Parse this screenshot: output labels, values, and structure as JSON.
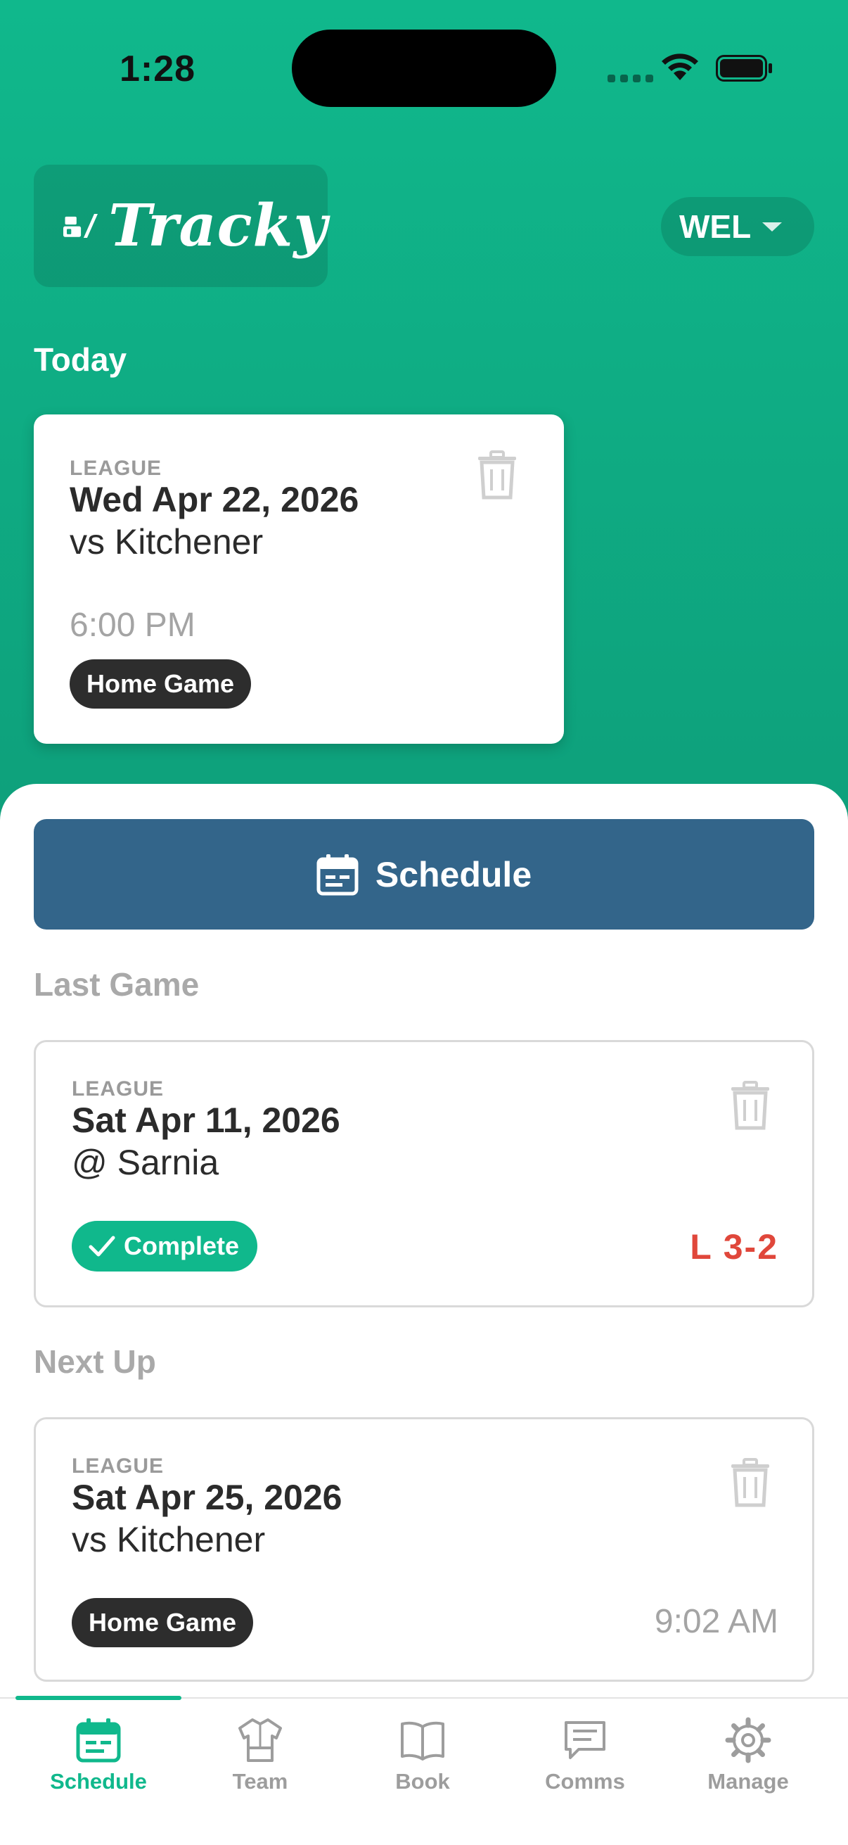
{
  "status_bar": {
    "time": "1:28"
  },
  "header": {
    "app_name": "Tracky",
    "team_code": "WEL"
  },
  "today": {
    "label": "Today",
    "game": {
      "type": "LEAGUE",
      "date": "Wed Apr 22, 2026",
      "opponent": "vs Kitchener",
      "time": "6:00 PM",
      "badge": "Home Game"
    }
  },
  "schedule_button": {
    "label": "Schedule"
  },
  "last_game": {
    "label": "Last Game",
    "game": {
      "type": "LEAGUE",
      "date": "Sat Apr 11, 2026",
      "opponent": "@ Sarnia",
      "status": "Complete",
      "result": "L 3-2"
    }
  },
  "next_up": {
    "label": "Next Up",
    "game": {
      "type": "LEAGUE",
      "date": "Sat Apr 25, 2026",
      "opponent": "vs Kitchener",
      "badge": "Home Game",
      "time": "9:02 AM"
    }
  },
  "tabs": [
    {
      "label": "Schedule",
      "icon": "calendar-icon",
      "active": true
    },
    {
      "label": "Team",
      "icon": "jersey-icon",
      "active": false
    },
    {
      "label": "Book",
      "icon": "book-icon",
      "active": false
    },
    {
      "label": "Comms",
      "icon": "message-icon",
      "active": false
    },
    {
      "label": "Manage",
      "icon": "gear-icon",
      "active": false
    }
  ],
  "colors": {
    "brand_green": "#10b88c",
    "schedule_blue": "#33658a",
    "loss_red": "#e0473b"
  }
}
